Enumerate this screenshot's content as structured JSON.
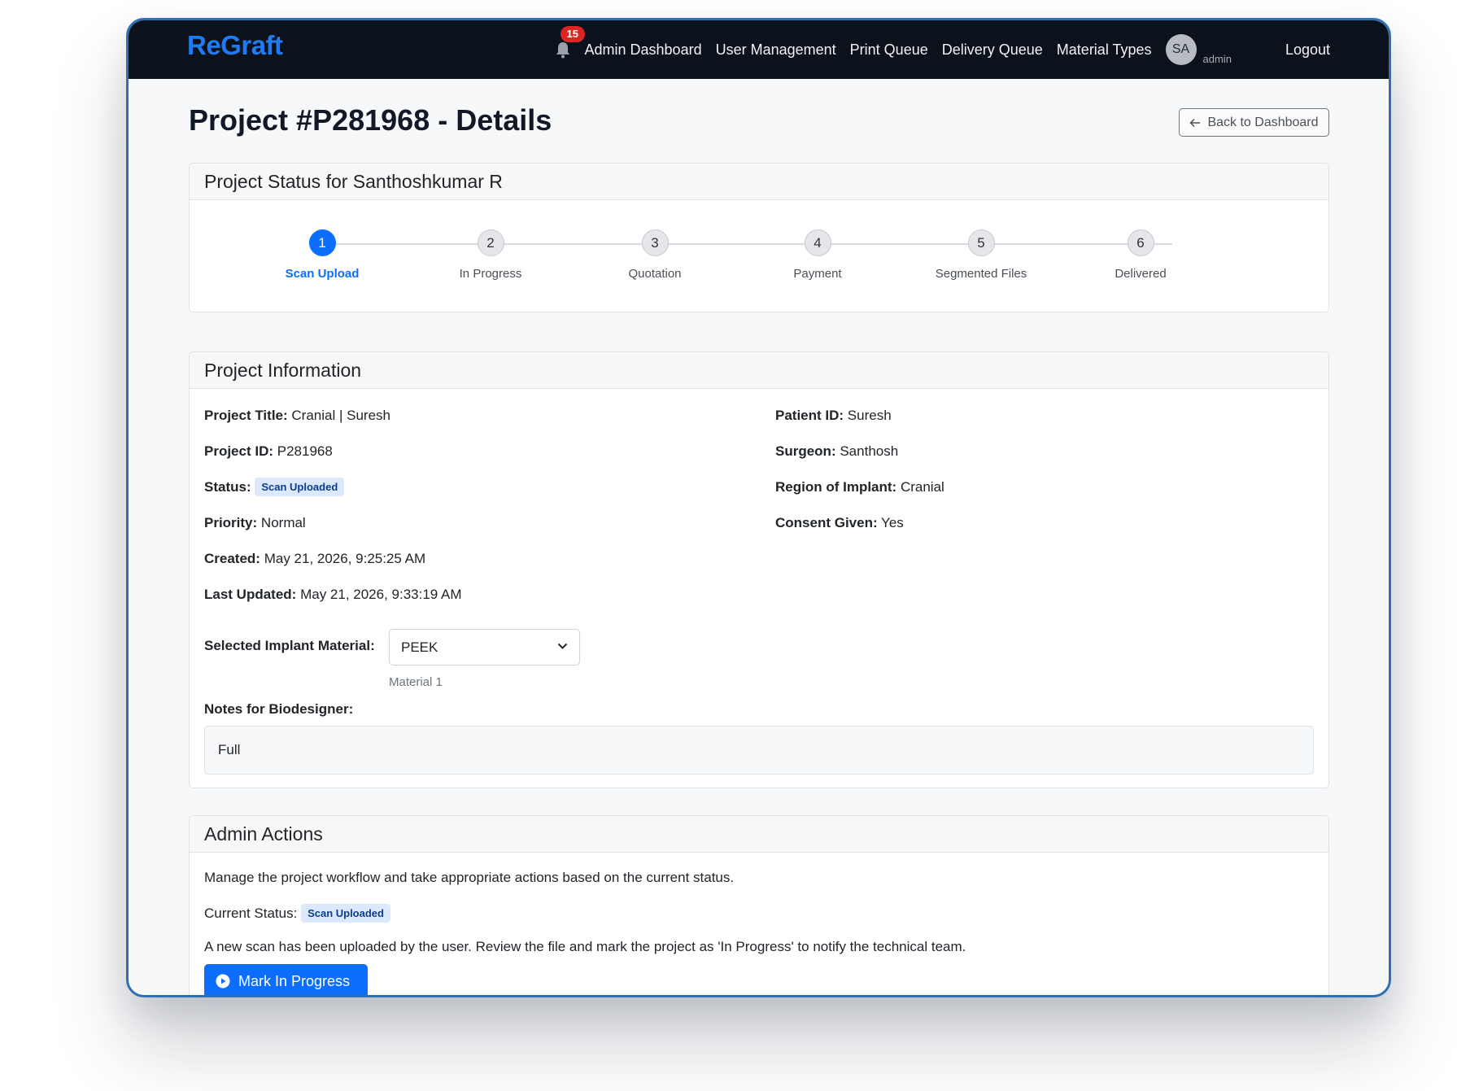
{
  "navbar": {
    "brand": "ReGraft",
    "notification_count": "15",
    "links": [
      "Admin Dashboard",
      "User Management",
      "Print Queue",
      "Delivery Queue",
      "Material Types"
    ],
    "avatar_initials": "SA",
    "avatar_label": "admin",
    "logout": "Logout"
  },
  "page": {
    "title": "Project #P281968 - Details",
    "back_label": "Back to Dashboard"
  },
  "status_card": {
    "header": "Project Status for Santhoshkumar R",
    "active_step": 1,
    "steps": [
      {
        "number": "1",
        "label": "Scan Upload"
      },
      {
        "number": "2",
        "label": "In Progress"
      },
      {
        "number": "3",
        "label": "Quotation"
      },
      {
        "number": "4",
        "label": "Payment"
      },
      {
        "number": "5",
        "label": "Segmented Files"
      },
      {
        "number": "6",
        "label": "Delivered"
      }
    ]
  },
  "info_card": {
    "header": "Project Information",
    "project_title_label": "Project Title:",
    "project_title": "Cranial | Suresh",
    "project_id_label": "Project ID:",
    "project_id": "P281968",
    "status_label": "Status:",
    "status": "Scan Uploaded",
    "priority_label": "Priority:",
    "priority": "Normal",
    "created_label": "Created:",
    "created": "May 21, 2026, 9:25:25 AM",
    "updated_label": "Last Updated:",
    "updated": "May 21, 2026, 9:33:19 AM",
    "patient_id_label": "Patient ID:",
    "patient_id": "Suresh",
    "surgeon_label": "Surgeon:",
    "surgeon": "Santhosh",
    "region_label": "Region of Implant:",
    "region": "Cranial",
    "consent_label": "Consent Given:",
    "consent": "Yes",
    "material_label": "Selected Implant Material:",
    "material_selected": "PEEK",
    "material_hint": "Material 1",
    "notes_label": "Notes for Biodesigner:",
    "notes": "Full"
  },
  "admin_card": {
    "header": "Admin Actions",
    "description": "Manage the project workflow and take appropriate actions based on the current status.",
    "current_status_label": "Current Status:",
    "current_status": "Scan Uploaded",
    "message": "A new scan has been uploaded by the user. Review the file and mark the project as 'In Progress' to notify the technical team.",
    "action_label": "Mark In Progress"
  },
  "colors": {
    "navbar_bg": "#0b121c",
    "brand": "#1e7bf2",
    "primary": "#0d6efd",
    "notification_badge": "#dc2626",
    "status_pill_bg": "#dce8fb"
  },
  "icons": [
    "bell-icon",
    "arrow-left-icon",
    "chevron-down-icon",
    "play-circle-icon"
  ]
}
